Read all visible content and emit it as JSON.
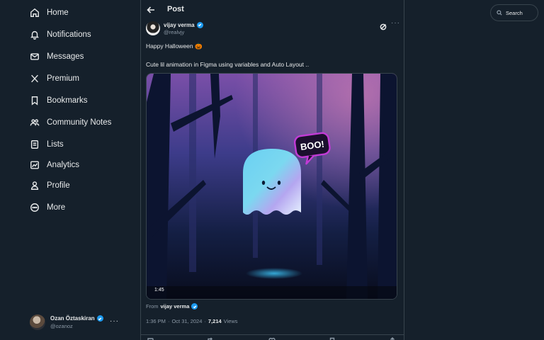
{
  "nav": {
    "items": [
      {
        "label": "Home",
        "icon": "home-icon"
      },
      {
        "label": "Notifications",
        "icon": "bell-icon"
      },
      {
        "label": "Messages",
        "icon": "envelope-icon"
      },
      {
        "label": "Premium",
        "icon": "x-logo-icon"
      },
      {
        "label": "Bookmarks",
        "icon": "bookmark-icon"
      },
      {
        "label": "Community Notes",
        "icon": "people-icon"
      },
      {
        "label": "Lists",
        "icon": "list-icon"
      },
      {
        "label": "Analytics",
        "icon": "chart-icon"
      },
      {
        "label": "Profile",
        "icon": "person-icon"
      },
      {
        "label": "More",
        "icon": "more-circle-icon"
      }
    ]
  },
  "account": {
    "name": "Ozan Öztaskiran",
    "handle": "@ozanoz",
    "more": "···"
  },
  "post": {
    "header_title": "Post",
    "author_name": "vijay verma",
    "author_handle": "@realvjy",
    "line1": "Happy Halloween 🎃",
    "line2": "Cute lil animation in Figma using variables and Auto Layout ..",
    "media": {
      "speech_text": "BOO!",
      "duration": "1:45"
    },
    "from_label": "From",
    "from_name": "vijay verma",
    "time": "1:36 PM",
    "sep1": "·",
    "date": "Oct 31, 2024",
    "sep2": "·",
    "views_count": "7,214",
    "views_label": "Views",
    "actions": {
      "replies": "",
      "reposts": "",
      "likes": "",
      "bookmarks": ""
    }
  },
  "search": {
    "placeholder": "Search"
  },
  "colors": {
    "background": "#15202b",
    "accent": "#1d9bf0",
    "text": "#e7e9ea",
    "muted": "#8b98a5",
    "border": "#38444d"
  }
}
